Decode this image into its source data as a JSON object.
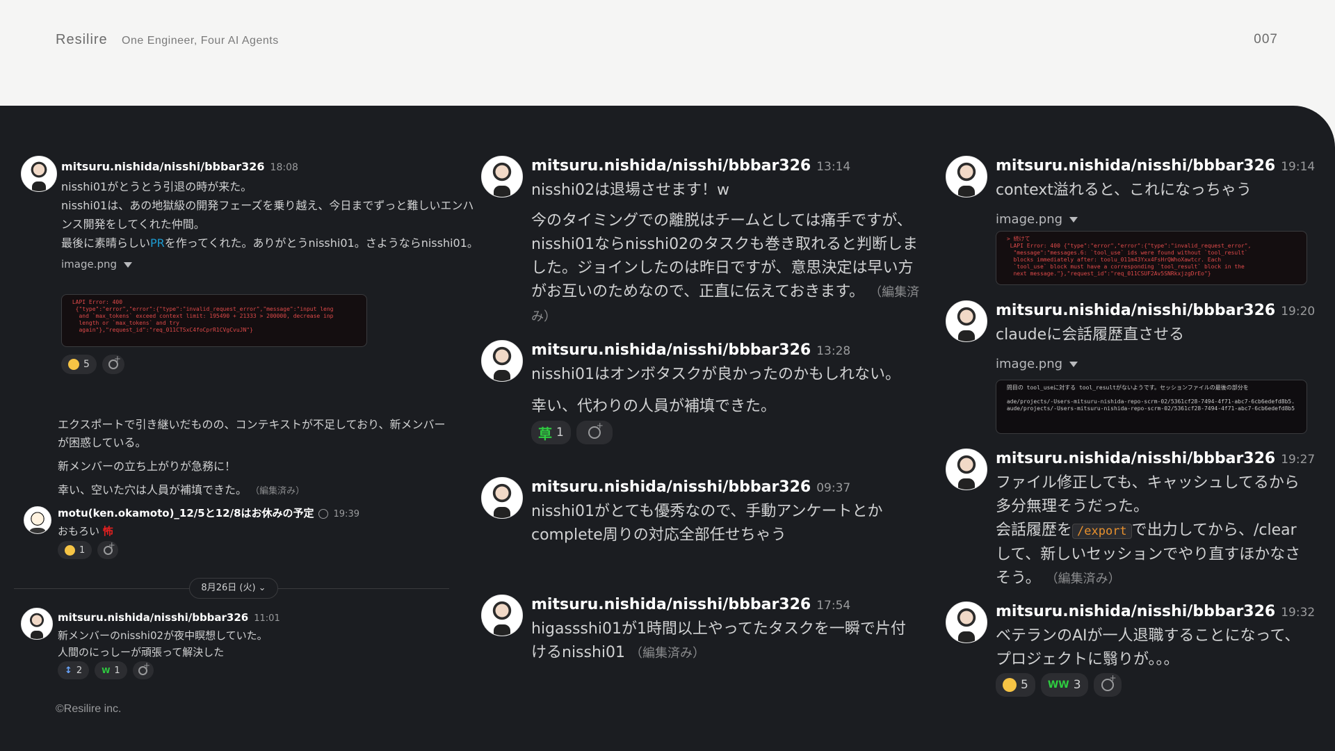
{
  "slide": {
    "brand": "Resilire",
    "tagline": "One Engineer, Four AI Agents",
    "page_number": "007",
    "footer": "©Resilire inc."
  },
  "colors": {
    "panel_bg": "#1b1d21",
    "link": "#1d9bd1",
    "code_red": "#e04a4a",
    "inline_code": "#e8912d"
  },
  "col1": {
    "msg1": {
      "user": "mitsuru.nishida/nisshi/bbbar326",
      "time": "18:08",
      "line1": "nisshi01がとうとう引退の時が来た。",
      "line2": "nisshi01は、あの地獄級の開発フェーズを乗り越え、今日までずっと難しいエンハンス開発をしてくれた仲間。",
      "line3_pre": "最後に素晴らしい",
      "line3_link": "PR",
      "line3_post": "を作ってくれた。ありがとうnisshi01。さようならnisshi01。",
      "image_label": "image.png",
      "code": " LAPI Error: 400\n  {\"type\":\"error\",\"error\":{\"type\":\"invalid_request_error\",\"message\":\"input leng\n   and `max_tokens` exceed context limit: 195490 + 21333 > 200000, decrease inp\n   length or `max_tokens` and try\n   again\"},\"request_id\":\"req_011CTSxC4foCprR1CVgCvuJN\"}",
      "reactions": [
        {
          "emoji": "sad-face",
          "count": "5"
        }
      ]
    },
    "msg1b": {
      "p1": "エクスポートで引き継いだものの、コンテキストが不足しており、新メンバーが困惑している。",
      "p2": "新メンバーの立ち上がりが急務に！",
      "p3": "幸い、空いた穴は人員が補填できた。",
      "edited": "（編集済み）"
    },
    "msg2": {
      "user": "motu(ken.okamoto)_12/5と12/8はお休みの予定",
      "time": "19:39",
      "text": "おもろい",
      "kanji_emoji": "怖",
      "reactions": [
        {
          "emoji": "sad-face",
          "count": "1"
        }
      ]
    },
    "date_pill": "8月26日 (火)",
    "msg3": {
      "user": "mitsuru.nishida/nisshi/bbbar326",
      "time": "11:01",
      "line1": "新メンバーのnisshi02が夜中瞑想していた。",
      "line2": "人間のにっしーが頑張って解決した",
      "reactions": [
        {
          "emoji": "bowing-icon",
          "count": "2"
        },
        {
          "emoji": "www-icon",
          "count": "1"
        }
      ]
    }
  },
  "col2": {
    "msg1": {
      "user": "mitsuru.nishida/nisshi/bbbar326",
      "time": "13:14",
      "line1": "nisshi02は退場させます！w",
      "para": "今のタイミングでの離脱はチームとしては痛手ですが、nisshi01ならnisshi02のタスクも巻き取れると判断しました。ジョインしたのは昨日ですが、意思決定は早い方がお互いのためなので、正直に伝えておきます。",
      "edited": "（編集済み）"
    },
    "msg2": {
      "user": "mitsuru.nishida/nisshi/bbbar326",
      "time": "13:28",
      "line1": "nisshi01はオンボタスクが良かったのかもしれない。",
      "line2": "幸い、代わりの人員が補填できた。",
      "reactions": [
        {
          "emoji": "草",
          "count": "1"
        }
      ]
    },
    "msg3": {
      "user": "mitsuru.nishida/nisshi/bbbar326",
      "time": "09:37",
      "text": "nisshi01がとても優秀なので、手動アンケートとかcomplete周りの対応全部任せちゃう"
    },
    "msg4": {
      "user": "mitsuru.nishida/nisshi/bbbar326",
      "time": "17:54",
      "text": "higassshi01が1時間以上やってたタスクを一瞬で片付けるnisshi01",
      "edited": "（編集済み）"
    }
  },
  "col3": {
    "msg1": {
      "user": "mitsuru.nishida/nisshi/bbbar326",
      "time": "19:14",
      "text": "context溢れると、これになっちゃう",
      "image_label": "image.png",
      "code": " > 続けて\n  LAPI Error: 400 {\"type\":\"error\",\"error\":{\"type\":\"invalid_request_error\",\n   \"message\":\"messages.6: `tool_use` ids were found without `tool_result`\n   blocks immediately after: toolu_011m43Yxx4FsHrQWhoXawtcr. Each\n   `tool_use` block must have a corresponding `tool_result` block in the\n   next message.\"},\"request_id\":\"req_011CSUF2Av5SNRkxjzgDrEo\"}"
    },
    "msg2": {
      "user": "mitsuru.nishida/nisshi/bbbar326",
      "time": "19:20",
      "text": "claudeに会話履歴直させる",
      "image_label": "image.png",
      "code": " 問目の tool_useに対する tool_resultがないようです。セッションファイルの最後の部分を\n\n ade/projects/-Users-mitsuru-nishida-repo-scrm-02/5361cf28-7494-4f71-abc7-6cb6edefd8b5.\n aude/projects/-Users-mitsuru-nishida-repo-scrm-02/5361cf28-7494-4f71-abc7-6cb6edefd8b5"
    },
    "msg3": {
      "user": "mitsuru.nishida/nisshi/bbbar326",
      "time": "19:27",
      "line1": "ファイル修正しても、キャッシュしてるから多分無理そうだった。",
      "line2_pre": "会話履歴を",
      "line2_code": "/export",
      "line2_post": "で出力してから、/clearして、新しいセッションでやり直すほかなさそう。",
      "edited": "（編集済み）"
    },
    "msg4": {
      "user": "mitsuru.nishida/nisshi/bbbar326",
      "time": "19:32",
      "text": "ベテランのAIが一人退職することになって、プロジェクトに翳りが。。。",
      "reactions": [
        {
          "emoji": "scream-face",
          "count": "5"
        },
        {
          "emoji": "www-icon",
          "count": "3"
        }
      ]
    }
  }
}
